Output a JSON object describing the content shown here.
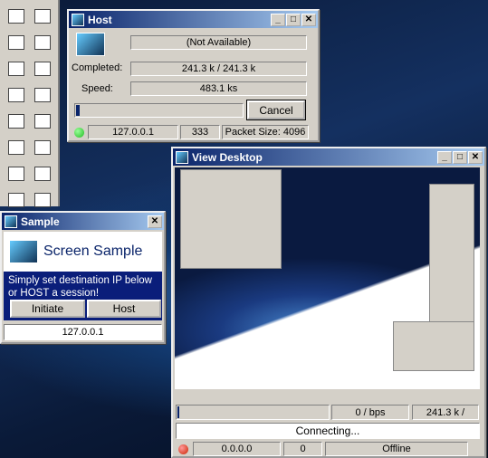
{
  "host": {
    "title": "Host",
    "status": "(Not Available)",
    "completed_label": "Completed:",
    "completed": "241.3 k / 241.3 k",
    "speed_label": "Speed:",
    "speed": "483.1 ks",
    "progress": 0.02,
    "cancel": "Cancel",
    "ip": "127.0.0.1",
    "port": "333",
    "packet": "Packet Size: 4096",
    "status_color": "#22bb22"
  },
  "sample": {
    "title": "Sample",
    "heading": "Screen Sample",
    "message": "Simply set destination IP below or HOST a session!",
    "initiate": "Initiate",
    "host": "Host",
    "ip": "127.0.0.1"
  },
  "view": {
    "title": "View Desktop",
    "progress": 0.01,
    "rate": "0 / bps",
    "size": "241.3 k /",
    "connecting": "Connecting...",
    "ip": "0.0.0.0",
    "port": "0",
    "state": "Offline",
    "status_color": "#cc2200"
  },
  "toolbar": {
    "icons": [
      "pointer-icon",
      "line-icon",
      "image-icon",
      "list-icon",
      "ole-icon",
      "frame-icon",
      "label-icon",
      "grid-icon",
      "dots-icon",
      "tree-icon",
      "matrix-icon",
      "tabs-icon",
      "chart-icon",
      "form-icon",
      "computer-icon",
      "computers-icon"
    ]
  }
}
